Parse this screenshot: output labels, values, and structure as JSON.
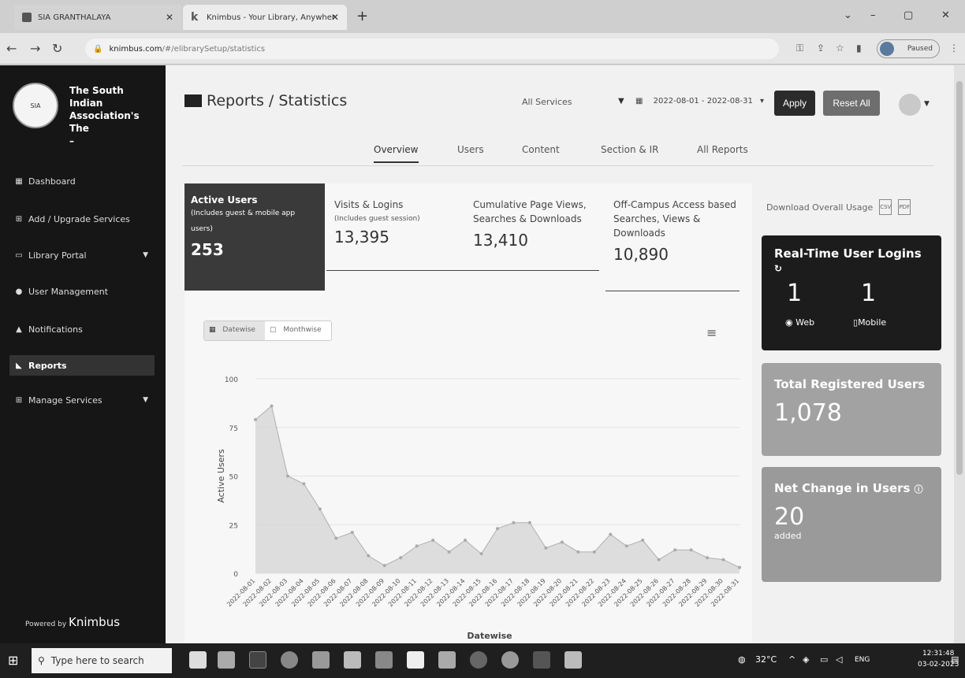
{
  "browser": {
    "tab1_title": "SIA GRANTHALAYA",
    "tab2_title": "Knimbus - Your Library, Anywher",
    "url_host": "knimbus.com",
    "url_path": "/#/elibrarySetup/statistics",
    "profile_label": "Paused"
  },
  "sidebar": {
    "org_name": "The South Indian Association's The",
    "org_ellipsis": "–",
    "items": [
      {
        "label": "Dashboard"
      },
      {
        "label": "Add / Upgrade Services"
      },
      {
        "label": "Library Portal"
      },
      {
        "label": "User Management"
      },
      {
        "label": "Notifications"
      },
      {
        "label": "Reports"
      },
      {
        "label": "Manage Services"
      }
    ],
    "powered_prefix": "Powered by",
    "powered_brand": "Knimbus"
  },
  "header": {
    "title": "Reports / Statistics",
    "service_select": "All Services",
    "date_range": "2022-08-01 - 2022-08-31",
    "apply_label": "Apply",
    "reset_label": "Reset All"
  },
  "tabs": [
    "Overview",
    "Users",
    "Content",
    "Section & IR",
    "All Reports"
  ],
  "stats": {
    "active": {
      "title": "Active Users",
      "sub": "(Includes guest & mobile app users)",
      "value": "253"
    },
    "visits": {
      "title": "Visits & Logins",
      "sub": "(Includes guest session)",
      "value": "13,395"
    },
    "pageviews": {
      "title": "Cumulative Page Views, Searches & Downloads",
      "value": "13,410"
    },
    "offcampus": {
      "title": "Off-Campus Access based Searches, Views & Downloads",
      "value": "10,890"
    }
  },
  "toggle": {
    "datewise": "Datewise",
    "monthwise": "Monthwise"
  },
  "right": {
    "download_label": "Download Overall Usage",
    "realtime_title": "Real-Time User Logins",
    "web_value": "1",
    "web_label": "Web",
    "mobile_value": "1",
    "mobile_label": "Mobile",
    "registered_title": "Total Registered Users",
    "registered_value": "1,078",
    "netchange_title": "Net Change in Users",
    "netchange_value": "20",
    "netchange_sub": "added"
  },
  "taskbar": {
    "search_placeholder": "Type here to search",
    "temperature": "32°C",
    "lang": "ENG",
    "time": "12:31:48",
    "date": "03-02-2023"
  },
  "colors": {
    "sidebar_bg": "#161616",
    "area_fill": "#d9d9d9",
    "area_line": "#b0b0b0",
    "card_gray": "#9a9a9a"
  },
  "chart_data": {
    "type": "area",
    "title": "",
    "xlabel": "Datewise",
    "ylabel": "Active Users",
    "ylim": [
      0,
      100
    ],
    "yticks": [
      0,
      25,
      50,
      75,
      100
    ],
    "x": [
      "2022-08-01",
      "2022-08-02",
      "2022-08-03",
      "2022-08-04",
      "2022-08-05",
      "2022-08-06",
      "2022-08-07",
      "2022-08-08",
      "2022-08-09",
      "2022-08-10",
      "2022-08-11",
      "2022-08-12",
      "2022-08-13",
      "2022-08-14",
      "2022-08-15",
      "2022-08-16",
      "2022-08-17",
      "2022-08-18",
      "2022-08-19",
      "2022-08-20",
      "2022-08-21",
      "2022-08-22",
      "2022-08-23",
      "2022-08-24",
      "2022-08-25",
      "2022-08-26",
      "2022-08-27",
      "2022-08-28",
      "2022-08-29",
      "2022-08-30",
      "2022-08-31"
    ],
    "series": [
      {
        "values": [
          79,
          86,
          50,
          46,
          33,
          18,
          21,
          9,
          4,
          8,
          14,
          17,
          11,
          17,
          10,
          23,
          26,
          26,
          13,
          16,
          11,
          11,
          20,
          14,
          17,
          7,
          12,
          12,
          8,
          7,
          3
        ]
      }
    ],
    "grid": true
  }
}
